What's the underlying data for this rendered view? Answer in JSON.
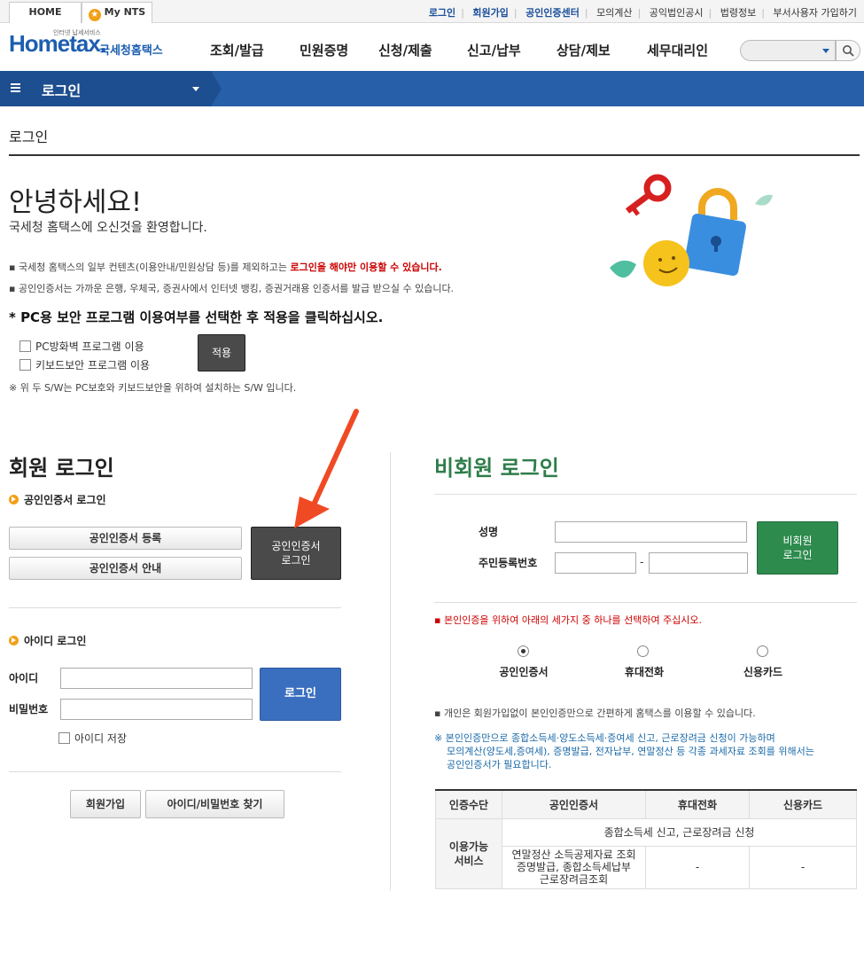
{
  "topbar": {
    "home": "HOME",
    "mynts": "My NTS",
    "links": [
      "로그인",
      "회원가입",
      "공인인증센터",
      "모의계산",
      "공익법인공시",
      "법령정보",
      "부서사용자 가입하기"
    ]
  },
  "header": {
    "logo_small": "인터넷 납세서비스",
    "logo_main": "Hometax.",
    "logo_kr": "국세청홈택스",
    "nav": [
      "조회/발급",
      "민원증명",
      "신청/제출",
      "신고/납부",
      "상담/제보",
      "세무대리인"
    ]
  },
  "band": {
    "label": "로그인"
  },
  "page": {
    "title": "로그인",
    "hello": "안녕하세요!",
    "welcome": "국세청 홈택스에 오신것을 환영합니다.",
    "note1_pre": "국세청 홈택스의 일부 컨텐츠(이용안내/민원상담 등)를 제외하고는 ",
    "note1_red": "로그인을 해야만 이용할 수 있습니다.",
    "note2": "공인인증서는 가까운 은행, 우체국, 증권사에서 인터넷 뱅킹, 증권거래용 인증서를 발급 받으실 수 있습니다.",
    "security_question": "* PC용 보안 프로그램 이용여부를 선택한 후 적용을 클릭하십시오.",
    "opt_firewall": "PC방화벽 프로그램 이용",
    "opt_keyboard": "키보드보안 프로그램 이용",
    "apply": "적용",
    "sw_note": "※ 위 두 S/W는 PC보호와 키보드보안을 위하여 설치하는 S/W 입니다."
  },
  "member": {
    "title": "회원 로그인",
    "cert_title": "공인인증서 로그인",
    "cert_register": "공인인증서 등록",
    "cert_guide": "공인인증서 안내",
    "cert_login_1": "공인인증서",
    "cert_login_2": "로그인",
    "id_title": "아이디 로그인",
    "id_label": "아이디",
    "pw_label": "비밀번호",
    "login": "로그인",
    "save_id": "아이디 저장",
    "join": "회원가입",
    "find": "아이디/비밀번호 찾기"
  },
  "nonmember": {
    "title": "비회원 로그인",
    "name_label": "성명",
    "rrn_label": "주민등록번호",
    "rrn_dash": "-",
    "login_1": "비회원",
    "login_2": "로그인",
    "select_note": "본인인증을 위하여 아래의 세가지 중 하나를 선택하여 주십시오.",
    "options": [
      "공인인증서",
      "휴대전화",
      "신용카드"
    ],
    "info": "개인은 회원가입없이 본인인증만으로 간편하게 홈택스를 이용할 수 있습니다.",
    "warn_1": "※ 본인인증만으로 종합소득세·양도소득세·증여세 신고, 근로장려금 신청이 가능하며",
    "warn_2": "모의계산(양도세,증여세), 증명발급, 전자납부, 연말정산 등 각종 과세자료 조회를 위해서는",
    "warn_3": "공인인증서가 필요합니다.",
    "table": {
      "headers": [
        "인증수단",
        "공인인증서",
        "휴대전화",
        "신용카드"
      ],
      "row_label_1": "이용가능",
      "row_label_2": "서비스",
      "row1": "종합소득세 신고, 근로장려금 신청",
      "row2_cert_1": "연말정산 소득공제자료 조회",
      "row2_cert_2": "증명발급, 종합소득세납부",
      "row2_cert_3": "근로장려금조회",
      "row2_phone": "-",
      "row2_card": "-"
    }
  },
  "colors": {
    "brand_blue": "#275fa8",
    "green": "#2e8b4e",
    "red_note": "#cc0000",
    "arrow": "#f04a24"
  }
}
